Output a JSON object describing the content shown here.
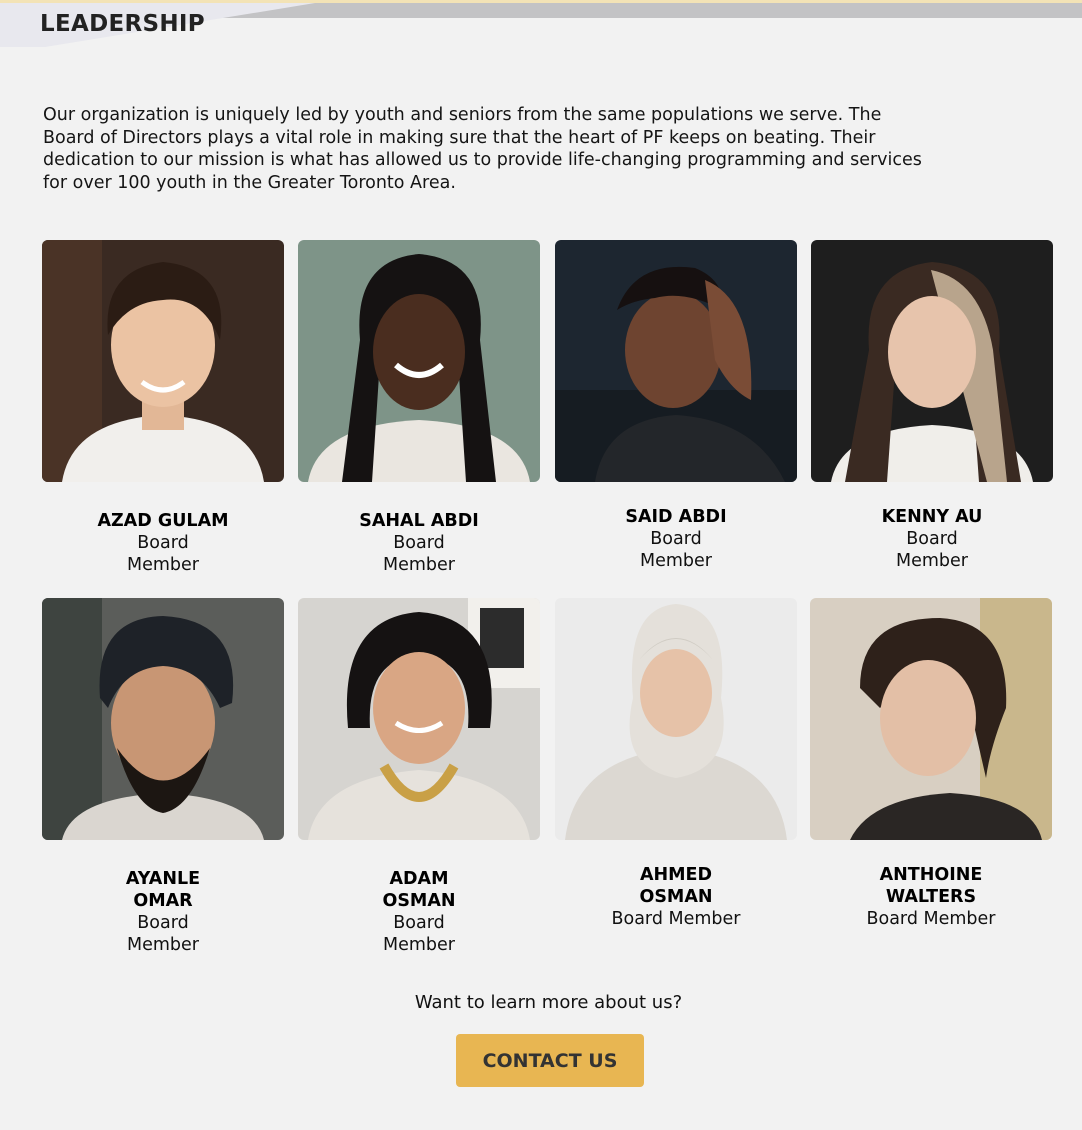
{
  "section": {
    "title": "LEADERSHIP"
  },
  "intro": {
    "text": "Our organization is uniquely led by youth and seniors from the same populations we serve. The Board of Directors plays a vital role in making sure that the heart of PF keeps on beating. Their dedication to our mission is what has allowed us to provide life-changing programming and services for over 100 youth in the Greater Toronto Area."
  },
  "members": [
    {
      "name": "AZAD GULAM",
      "role": "Board Member"
    },
    {
      "name": "SAHAL ABDI",
      "role": "Board Member"
    },
    {
      "name": "SAID ABDI",
      "role": "Board Member"
    },
    {
      "name": "KENNY AU",
      "role": "Board Member"
    },
    {
      "name": "AYANLE OMAR",
      "role": "Board Member"
    },
    {
      "name": "ADAM OSMAN",
      "role": "Board Member"
    },
    {
      "name": "AHMED OSMAN",
      "role": "Board Member"
    },
    {
      "name": "ANTHOINE WALTERS",
      "role": "Board Member"
    }
  ],
  "cta": {
    "prompt": "Want to learn more about us?",
    "button_label": "CONTACT US"
  },
  "colors": {
    "background": "#f2f2f2",
    "accent": "#e8b652",
    "header_band": "#c3c3c5",
    "top_strip": "#f3e3b6"
  }
}
